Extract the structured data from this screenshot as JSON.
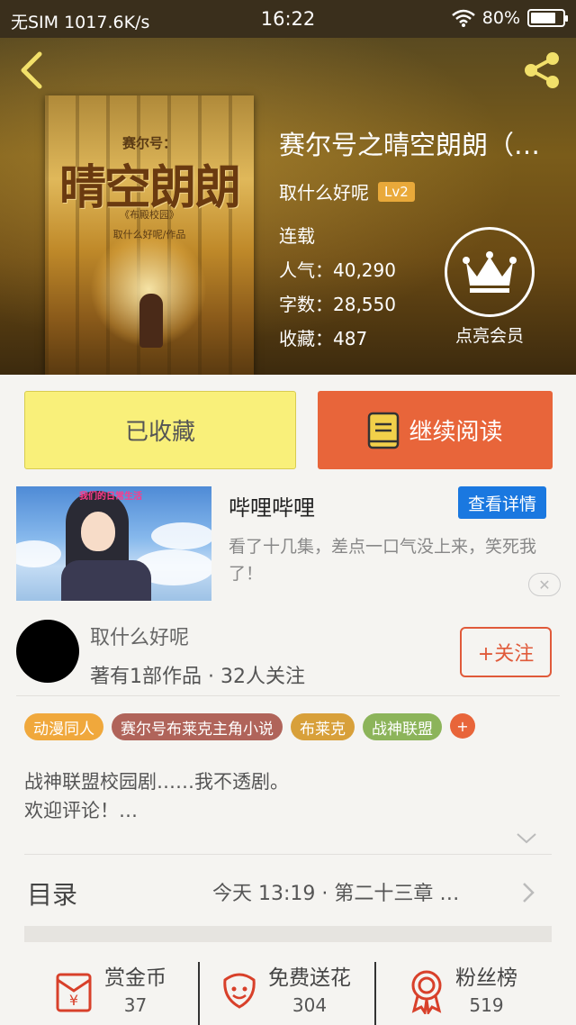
{
  "status_bar": {
    "left": "无SIM 1017.6K/s",
    "time": "16:22",
    "battery": "80%",
    "battery_level": 0.8
  },
  "book": {
    "title": "赛尔号之晴空朗朗（…",
    "author": "取什么好呢",
    "level": "Lv2",
    "status": "连载",
    "popularity_label": "人气：",
    "popularity": "40,290",
    "words_label": "字数：",
    "words": "28,550",
    "favorites_label": "收藏：",
    "favorites": "487",
    "cover": {
      "small_title": "赛尔号：",
      "big_title": "晴空朗朗",
      "subtitle": "《布殿校园》",
      "byline": "取什么好呢/作品"
    }
  },
  "member": {
    "label": "点亮会员"
  },
  "actions": {
    "favorited": "已收藏",
    "continue_reading": "继续阅读"
  },
  "ad": {
    "title": "哔哩哔哩",
    "detail_button": "查看详情",
    "description": "看了十几集，差点一口气没上来，笑死我了！",
    "image_caption": "我们的日常生活"
  },
  "author_card": {
    "name": "取什么好呢",
    "stats": "著有1部作品 · 32人关注",
    "follow": "+关注"
  },
  "tags": [
    {
      "label": "动漫同人",
      "color": "#f0a83c"
    },
    {
      "label": "赛尔号布莱克主角小说",
      "color": "#b0645a"
    },
    {
      "label": "布莱克",
      "color": "#d8a03a"
    },
    {
      "label": "战神联盟",
      "color": "#8cb45a"
    }
  ],
  "tag_more": "+",
  "intro": {
    "line1": "战神联盟校园剧……我不透剧。",
    "line2": "欢迎评论！…"
  },
  "toc": {
    "label": "目录",
    "latest": "今天 13:19 · 第二十三章 …"
  },
  "bottom": {
    "reward": {
      "label": "赏金币",
      "value": "37"
    },
    "flowers": {
      "label": "免费送花",
      "value": "304"
    },
    "fans": {
      "label": "粉丝榜",
      "value": "519"
    }
  },
  "colors": {
    "accent": "#e8653a",
    "favorite_bg": "#f9f07a",
    "ad_button": "#1a78e0"
  }
}
